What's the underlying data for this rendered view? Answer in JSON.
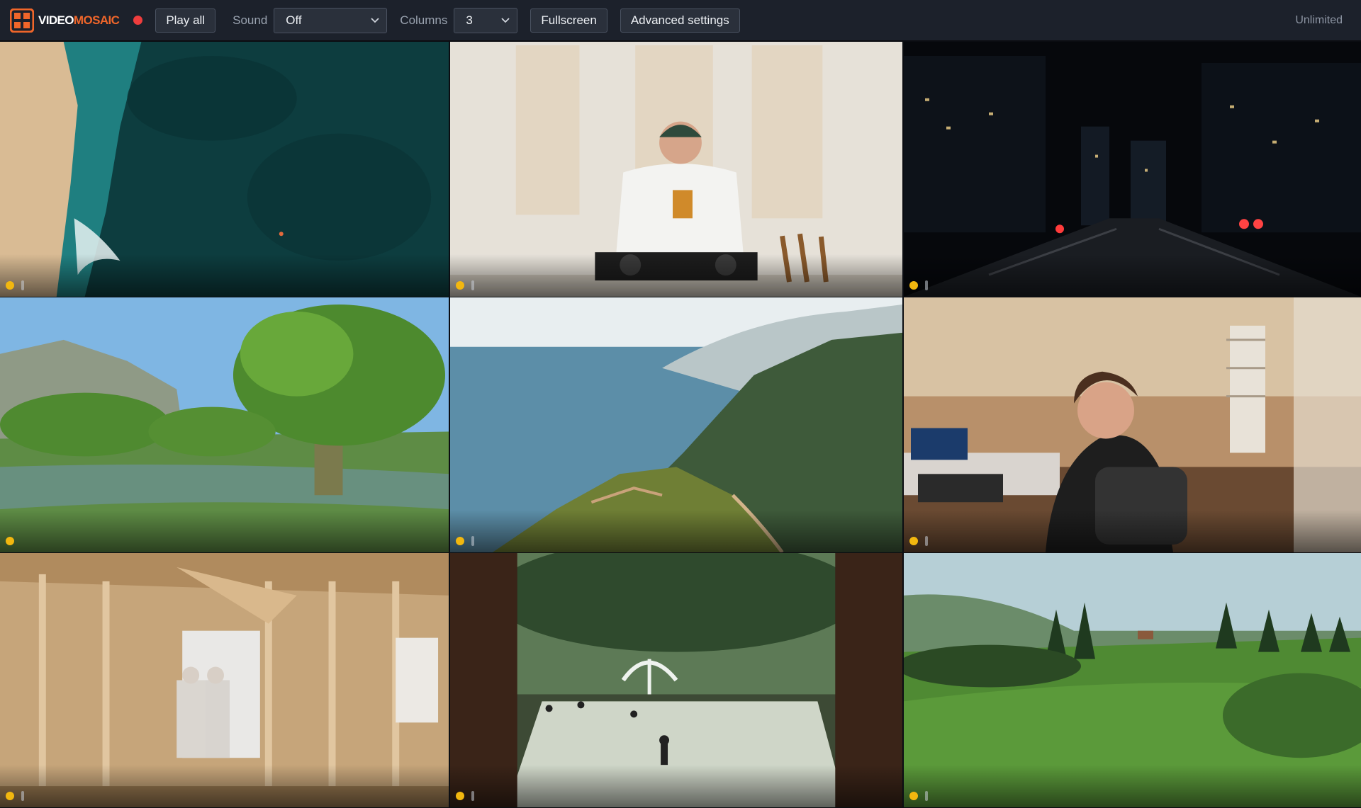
{
  "app": {
    "logo_text_part1": "VIDEO",
    "logo_text_part2": "MOSAIC"
  },
  "toolbar": {
    "play_all_label": "Play all",
    "sound_label": "Sound",
    "sound_value": "Off",
    "columns_label": "Columns",
    "columns_value": "3",
    "fullscreen_label": "Fullscreen",
    "advanced_settings_label": "Advanced settings",
    "limit_text": "Unlimited"
  },
  "colors": {
    "toolbar_bg": "#1c212b",
    "accent_orange": "#f0662a",
    "record_red": "#ef3d3d",
    "status_yellow": "#f2b70f"
  },
  "tiles": [
    {
      "id": "aerial-beach"
    },
    {
      "id": "dj-studio"
    },
    {
      "id": "night-city"
    },
    {
      "id": "game-forest"
    },
    {
      "id": "coastal-mountain"
    },
    {
      "id": "streamer-room"
    },
    {
      "id": "house-framing"
    },
    {
      "id": "courtyard-skaters"
    },
    {
      "id": "green-meadow"
    }
  ]
}
